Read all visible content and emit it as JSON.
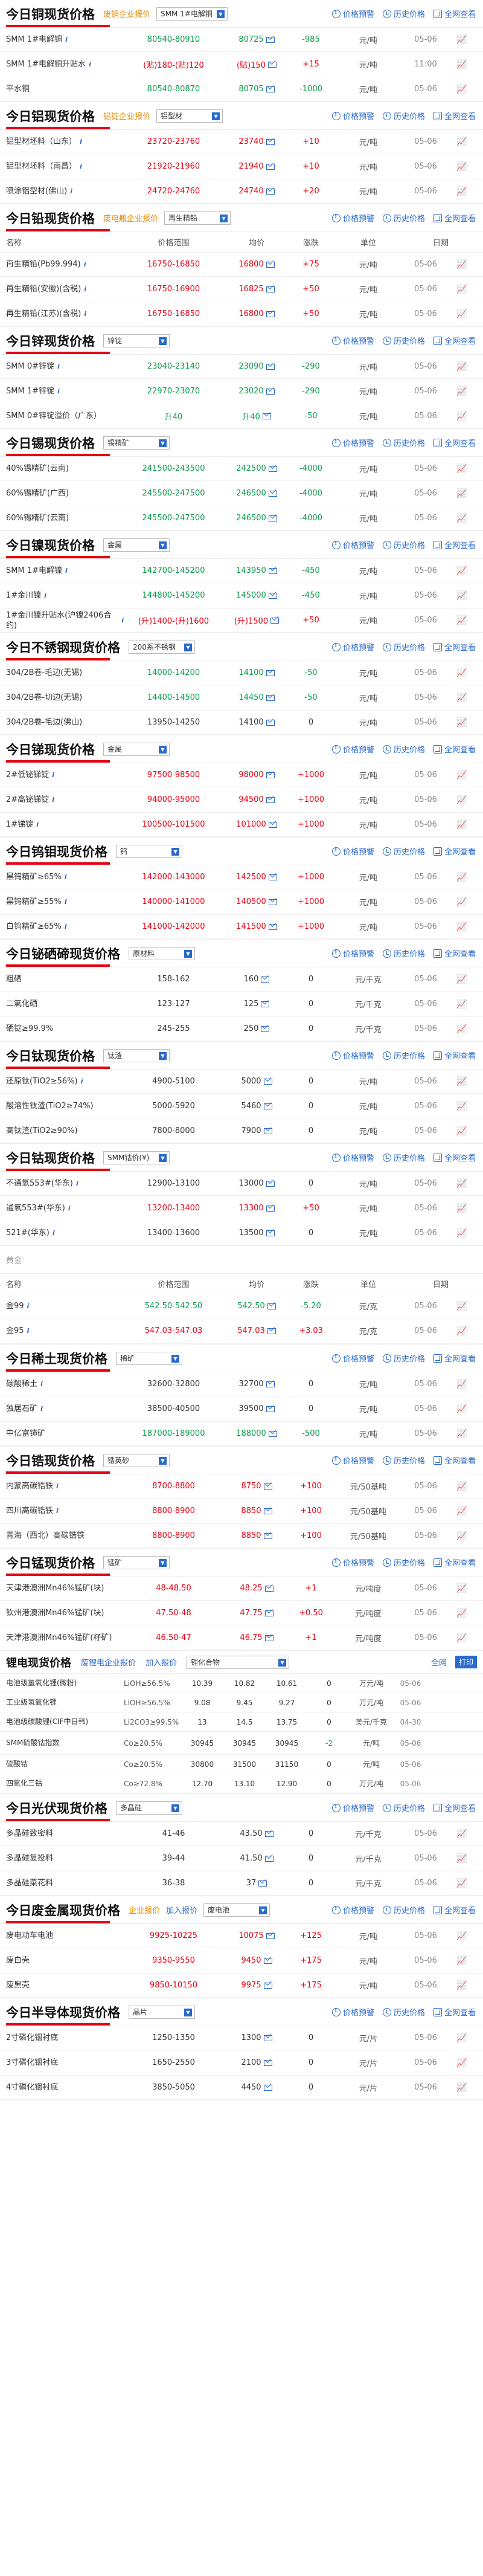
{
  "ui": {
    "price_history": "价格预警",
    "history": "历史价格",
    "all_view": "全网查看",
    "enterprise_quote": "废铜企业报价",
    "enterprise_quote_al": "铝锭企业报价",
    "enterprise_quote_pb": "废电瓶企业报价",
    "add_quote": "加入报价",
    "join": "加入",
    "col_name": "名称",
    "col_range": "价格范围",
    "col_avg": "均价",
    "col_chg": "涨跌",
    "col_unit": "单位",
    "col_date": "日期"
  },
  "sections": [
    {
      "title": "今日铜现货价格",
      "tag": "废铜企业报价",
      "dropdown": "SMM 1#电解铜",
      "show_header": false,
      "rows": [
        {
          "name": "SMM 1#电解铜",
          "range": "80540-80910",
          "avg": "80725",
          "chg": "-985",
          "dir": "down",
          "unit": "元/吨",
          "date": "05-06",
          "info": true
        },
        {
          "name": "SMM 1#电解铜升贴水",
          "range": "(贴)180-(贴)120",
          "avg": "(贴)150",
          "chg": "+15",
          "dir": "up",
          "unit": "元/吨",
          "date": "11:00",
          "info": true
        },
        {
          "name": "平水铜",
          "range": "80540-80870",
          "avg": "80705",
          "chg": "-1000",
          "dir": "down",
          "unit": "元/吨",
          "date": "05-06",
          "info": false
        }
      ]
    },
    {
      "title": "今日铝现货价格",
      "tag": "铝锭企业报价",
      "dropdown": "铝型材",
      "show_header": false,
      "rows": [
        {
          "name": "铝型材坯料（山东）",
          "range": "23720-23760",
          "avg": "23740",
          "chg": "+10",
          "dir": "up",
          "unit": "元/吨",
          "date": "05-06",
          "info": true
        },
        {
          "name": "铝型材坯料（南昌）",
          "range": "21920-21960",
          "avg": "21940",
          "chg": "+10",
          "dir": "up",
          "unit": "元/吨",
          "date": "05-06",
          "info": true
        },
        {
          "name": "喷涂铝型材(佛山)",
          "range": "24720-24760",
          "avg": "24740",
          "chg": "+20",
          "dir": "up",
          "unit": "元/吨",
          "date": "05-06",
          "info": true
        }
      ]
    },
    {
      "title": "今日铅现货价格",
      "tag": "废电瓶企业报价",
      "dropdown": "再生精铅",
      "show_header": true,
      "rows": [
        {
          "name": "再生精铅(Pb99.994)",
          "range": "16750-16850",
          "avg": "16800",
          "chg": "+75",
          "dir": "up",
          "unit": "元/吨",
          "date": "05-06",
          "info": true
        },
        {
          "name": "再生精铅(安徽)(含税)",
          "range": "16750-16900",
          "avg": "16825",
          "chg": "+50",
          "dir": "up",
          "unit": "元/吨",
          "date": "05-06",
          "info": true
        },
        {
          "name": "再生精铅(江苏)(含税)",
          "range": "16750-16850",
          "avg": "16800",
          "chg": "+50",
          "dir": "up",
          "unit": "元/吨",
          "date": "05-06",
          "info": true
        }
      ]
    },
    {
      "title": "今日锌现货价格",
      "tag": "",
      "dropdown": "锌锭",
      "show_header": false,
      "rows": [
        {
          "name": "SMM 0#锌锭",
          "range": "23040-23140",
          "avg": "23090",
          "chg": "-290",
          "dir": "down",
          "unit": "元/吨",
          "date": "05-06",
          "info": true
        },
        {
          "name": "SMM 1#锌锭",
          "range": "22970-23070",
          "avg": "23020",
          "chg": "-290",
          "dir": "down",
          "unit": "元/吨",
          "date": "05-06",
          "info": true
        },
        {
          "name": "SMM 0#锌锭溢价（广东）",
          "range": "升40",
          "avg": "升40",
          "chg": "-50",
          "dir": "down",
          "unit": "元/吨",
          "date": "05-06",
          "info": false
        }
      ]
    },
    {
      "title": "今日锡现货价格",
      "tag": "",
      "dropdown": "锡精矿",
      "show_header": false,
      "rows": [
        {
          "name": "40%锡精矿(云南)",
          "range": "241500-243500",
          "avg": "242500",
          "chg": "-4000",
          "dir": "down",
          "unit": "元/吨",
          "date": "05-06",
          "info": false
        },
        {
          "name": "60%锡精矿(广西)",
          "range": "245500-247500",
          "avg": "246500",
          "chg": "-4000",
          "dir": "down",
          "unit": "元/吨",
          "date": "05-06",
          "info": false
        },
        {
          "name": "60%锡精矿(云南)",
          "range": "245500-247500",
          "avg": "246500",
          "chg": "-4000",
          "dir": "down",
          "unit": "元/吨",
          "date": "05-06",
          "info": false
        }
      ]
    },
    {
      "title": "今日镍现货价格",
      "tag": "",
      "dropdown": "金属",
      "show_header": false,
      "rows": [
        {
          "name": "SMM 1#电解镍",
          "range": "142700-145200",
          "avg": "143950",
          "chg": "-450",
          "dir": "down",
          "unit": "元/吨",
          "date": "05-06",
          "info": true
        },
        {
          "name": "1#金川镍",
          "range": "144800-145200",
          "avg": "145000",
          "chg": "-450",
          "dir": "down",
          "unit": "元/吨",
          "date": "05-06",
          "info": true
        },
        {
          "name": "1#金川镍升贴水(沪镍2406合约)",
          "range": "(升)1400-(升)1600",
          "avg": "(升)1500",
          "chg": "+50",
          "dir": "up",
          "unit": "元/吨",
          "date": "05-06",
          "info": true
        }
      ]
    },
    {
      "title": "今日不锈钢现货价格",
      "tag": "",
      "dropdown": "200系不锈钢",
      "show_header": false,
      "rows": [
        {
          "name": "304/2B卷-毛边(无锡)",
          "range": "14000-14200",
          "avg": "14100",
          "chg": "-50",
          "dir": "down",
          "unit": "元/吨",
          "date": "05-06",
          "info": false
        },
        {
          "name": "304/2B卷-切边(无锡)",
          "range": "14400-14500",
          "avg": "14450",
          "chg": "-50",
          "dir": "down",
          "unit": "元/吨",
          "date": "05-06",
          "info": false
        },
        {
          "name": "304/2B卷-毛边(佛山)",
          "range": "13950-14250",
          "avg": "14100",
          "chg": "0",
          "dir": "flat",
          "unit": "元/吨",
          "date": "05-06",
          "info": false
        }
      ]
    },
    {
      "title": "今日锑现货价格",
      "tag": "",
      "dropdown": "金属",
      "show_header": false,
      "rows": [
        {
          "name": "2#低铋锑锭",
          "range": "97500-98500",
          "avg": "98000",
          "chg": "+1000",
          "dir": "up",
          "unit": "元/吨",
          "date": "05-06",
          "info": true
        },
        {
          "name": "2#高铋锑锭",
          "range": "94000-95000",
          "avg": "94500",
          "chg": "+1000",
          "dir": "up",
          "unit": "元/吨",
          "date": "05-06",
          "info": true
        },
        {
          "name": "1#锑锭",
          "range": "100500-101500",
          "avg": "101000",
          "chg": "+1000",
          "dir": "up",
          "unit": "元/吨",
          "date": "05-06",
          "info": true
        }
      ]
    },
    {
      "title": "今日钨钼现货价格",
      "tag": "",
      "dropdown": "钨",
      "show_header": false,
      "rows": [
        {
          "name": "黑钨精矿≥65%",
          "range": "142000-143000",
          "avg": "142500",
          "chg": "+1000",
          "dir": "up",
          "unit": "元/吨",
          "date": "05-06",
          "info": true
        },
        {
          "name": "黑钨精矿≥55%",
          "range": "140000-141000",
          "avg": "140500",
          "chg": "+1000",
          "dir": "up",
          "unit": "元/吨",
          "date": "05-06",
          "info": true
        },
        {
          "name": "白钨精矿≥65%",
          "range": "141000-142000",
          "avg": "141500",
          "chg": "+1000",
          "dir": "up",
          "unit": "元/吨",
          "date": "05-06",
          "info": true
        }
      ]
    },
    {
      "title": "今日铋硒碲现货价格",
      "tag": "",
      "dropdown": "原材料",
      "show_header": false,
      "rows": [
        {
          "name": "粗硒",
          "range": "158-162",
          "avg": "160",
          "chg": "0",
          "dir": "flat",
          "unit": "元/千克",
          "date": "05-06",
          "info": false
        },
        {
          "name": "二氧化硒",
          "range": "123-127",
          "avg": "125",
          "chg": "0",
          "dir": "flat",
          "unit": "元/千克",
          "date": "05-06",
          "info": false
        },
        {
          "name": "硒锭≥99.9%",
          "range": "245-255",
          "avg": "250",
          "chg": "0",
          "dir": "flat",
          "unit": "元/千克",
          "date": "05-06",
          "info": false
        }
      ]
    },
    {
      "title": "今日钛现货价格",
      "tag": "",
      "dropdown": "钛渣",
      "show_header": false,
      "rows": [
        {
          "name": "还原钛(TiO2≥56%)",
          "range": "4900-5100",
          "avg": "5000",
          "chg": "0",
          "dir": "flat",
          "unit": "元/吨",
          "date": "05-06",
          "info": true
        },
        {
          "name": "酸溶性钛渣(TiO2≥74%)",
          "range": "5000-5920",
          "avg": "5460",
          "chg": "0",
          "dir": "flat",
          "unit": "元/吨",
          "date": "05-06",
          "info": false
        },
        {
          "name": "高钛渣(TiO2≥90%)",
          "range": "7800-8000",
          "avg": "7900",
          "chg": "0",
          "dir": "flat",
          "unit": "元/吨",
          "date": "05-06",
          "info": false
        }
      ]
    },
    {
      "title": "今日钴现货价格",
      "tag": "",
      "dropdown": "SMM钴价(¥)",
      "show_header": false,
      "rows": [
        {
          "name": "不通氧553#(华东)",
          "range": "12900-13100",
          "avg": "13000",
          "chg": "0",
          "dir": "flat",
          "unit": "元/吨",
          "date": "05-06",
          "info": true
        },
        {
          "name": "通氧553#(华东)",
          "range": "13200-13400",
          "avg": "13300",
          "chg": "+50",
          "dir": "up",
          "unit": "元/吨",
          "date": "05-06",
          "info": true
        },
        {
          "name": "521#(华东)",
          "range": "13400-13600",
          "avg": "13500",
          "chg": "0",
          "dir": "flat",
          "unit": "元/吨",
          "date": "05-06",
          "info": true
        }
      ]
    },
    {
      "title": "",
      "tag": "黄金",
      "dropdown": "",
      "show_header": true,
      "plain": true,
      "rows": [
        {
          "name": "金99",
          "range": "542.50-542.50",
          "avg": "542.50",
          "chg": "-5.20",
          "dir": "down",
          "unit": "元/克",
          "date": "05-06",
          "info": true
        },
        {
          "name": "金95",
          "range": "547.03-547.03",
          "avg": "547.03",
          "chg": "+3.03",
          "dir": "up",
          "unit": "元/克",
          "date": "05-06",
          "info": true
        }
      ]
    },
    {
      "title": "今日稀土现货价格",
      "tag": "",
      "dropdown": "稀矿",
      "show_header": false,
      "rows": [
        {
          "name": "碳酸稀土",
          "range": "32600-32800",
          "avg": "32700",
          "chg": "0",
          "dir": "flat",
          "unit": "元/吨",
          "date": "05-06",
          "info": true
        },
        {
          "name": "独居石矿",
          "range": "38500-40500",
          "avg": "39500",
          "chg": "0",
          "dir": "flat",
          "unit": "元/吨",
          "date": "05-06",
          "info": true
        },
        {
          "name": "中亿富铈矿",
          "range": "187000-189000",
          "avg": "188000",
          "chg": "-500",
          "dir": "down",
          "unit": "元/吨",
          "date": "05-06",
          "info": false
        }
      ]
    },
    {
      "title": "今日锆现货价格",
      "tag": "",
      "dropdown": "锆英砂",
      "show_header": false,
      "rows": [
        {
          "name": "内蒙高碳锆铁",
          "range": "8700-8800",
          "avg": "8750",
          "chg": "+100",
          "dir": "up",
          "unit": "元/50基吨",
          "date": "05-06",
          "info": true
        },
        {
          "name": "四川高碳锆铁",
          "range": "8800-8900",
          "avg": "8850",
          "chg": "+100",
          "dir": "up",
          "unit": "元/50基吨",
          "date": "05-06",
          "info": true
        },
        {
          "name": "青海（西北）高碳锆铁",
          "range": "8800-8900",
          "avg": "8850",
          "chg": "+100",
          "dir": "up",
          "unit": "元/50基吨",
          "date": "05-06",
          "info": false
        }
      ]
    },
    {
      "title": "今日锰现货价格",
      "tag": "",
      "dropdown": "锰矿",
      "show_header": false,
      "rows": [
        {
          "name": "天津港澳洲Mn46%锰矿(块)",
          "range": "48-48.50",
          "avg": "48.25",
          "chg": "+1",
          "dir": "up",
          "unit": "元/吨度",
          "date": "05-06",
          "info": false
        },
        {
          "name": "钦州港澳洲Mn46%锰矿(块)",
          "range": "47.50-48",
          "avg": "47.75",
          "chg": "+0.50",
          "dir": "up",
          "unit": "元/吨度",
          "date": "05-06",
          "info": false
        },
        {
          "name": "天津港澳洲Mn46%锰矿(籽矿)",
          "range": "46.50-47",
          "avg": "46.75",
          "chg": "+1",
          "dir": "up",
          "unit": "元/吨度",
          "date": "05-06",
          "info": false
        }
      ]
    }
  ],
  "lithium": {
    "title": "锂电现货价格",
    "tag1": "废锂电企业报价",
    "tag2": "加入报价",
    "dropdown": "锂化合物",
    "btn": "全网",
    "btn2": "打印",
    "rows": [
      {
        "name": "电池级氢氧化锂(微粉)",
        "spec": "LiOH≥56.5%",
        "c1": "10.39",
        "c2": "10.82",
        "c3": "10.61",
        "chg": "0",
        "dir": "flat",
        "unit": "万元/吨",
        "date": "05-06"
      },
      {
        "name": "工业级氢氧化锂",
        "spec": "LiOH≥56.5%",
        "c1": "9.08",
        "c2": "9.45",
        "c3": "9.27",
        "chg": "0",
        "dir": "flat",
        "unit": "万元/吨",
        "date": "05-06"
      },
      {
        "name": "电池级碳酸锂(CIF中日韩)",
        "spec": "Li2CO3≥99.5%",
        "c1": "13",
        "c2": "14.5",
        "c3": "13.75",
        "chg": "0",
        "dir": "flat",
        "unit": "美元/千克",
        "date": "04-30"
      },
      {
        "name": "SMM硫酸钴指数",
        "spec": "Co≥20.5%",
        "c1": "30945",
        "c2": "30945",
        "c3": "30945",
        "chg": "-2",
        "dir": "down",
        "unit": "元/吨",
        "date": "05-06"
      },
      {
        "name": "硫酸钴",
        "spec": "Co≥20.5%",
        "c1": "30800",
        "c2": "31500",
        "c3": "31150",
        "chg": "0",
        "dir": "flat",
        "unit": "元/吨",
        "date": "05-06"
      },
      {
        "name": "四氧化三钴",
        "spec": "Co≥72.8%",
        "c1": "12.70",
        "c2": "13.10",
        "c3": "12.90",
        "chg": "0",
        "dir": "flat",
        "unit": "万元/吨",
        "date": "05-06"
      }
    ]
  },
  "sections2": [
    {
      "title": "今日光伏现货价格",
      "tag": "",
      "dropdown": "多晶硅",
      "show_header": false,
      "rows": [
        {
          "name": "多晶硅致密料",
          "range": "41-46",
          "avg": "43.50",
          "chg": "0",
          "dir": "flat",
          "unit": "元/千克",
          "date": "05-06",
          "info": false
        },
        {
          "name": "多晶硅复投料",
          "range": "39-44",
          "avg": "41.50",
          "chg": "0",
          "dir": "flat",
          "unit": "元/千克",
          "date": "05-06",
          "info": false
        },
        {
          "name": "多晶硅菜花料",
          "range": "36-38",
          "avg": "37",
          "chg": "0",
          "dir": "flat",
          "unit": "元/千克",
          "date": "05-06",
          "info": false
        }
      ]
    },
    {
      "title": "今日废金属现货价格",
      "tag": "企业报价",
      "tag2": "加入报价",
      "dropdown": "废电池",
      "show_header": false,
      "rows": [
        {
          "name": "废电动车电池",
          "range": "9925-10225",
          "avg": "10075",
          "chg": "+125",
          "dir": "up",
          "unit": "元/吨",
          "date": "05-06",
          "info": false
        },
        {
          "name": "废白壳",
          "range": "9350-9550",
          "avg": "9450",
          "chg": "+175",
          "dir": "up",
          "unit": "元/吨",
          "date": "05-06",
          "info": false
        },
        {
          "name": "废黑壳",
          "range": "9850-10150",
          "avg": "9975",
          "chg": "+175",
          "dir": "up",
          "unit": "元/吨",
          "date": "05-06",
          "info": false
        }
      ]
    },
    {
      "title": "今日半导体现货价格",
      "tag": "",
      "dropdown": "晶片",
      "show_header": false,
      "rows": [
        {
          "name": "2寸磷化铟衬底",
          "range": "1250-1350",
          "avg": "1300",
          "chg": "0",
          "dir": "flat",
          "unit": "元/片",
          "date": "05-06",
          "info": false
        },
        {
          "name": "3寸磷化铟衬底",
          "range": "1650-2550",
          "avg": "2100",
          "chg": "0",
          "dir": "flat",
          "unit": "元/片",
          "date": "05-06",
          "info": false
        },
        {
          "name": "4寸磷化铟衬底",
          "range": "3850-5050",
          "avg": "4450",
          "chg": "0",
          "dir": "flat",
          "unit": "元/片",
          "date": "05-06",
          "info": false
        }
      ]
    }
  ]
}
